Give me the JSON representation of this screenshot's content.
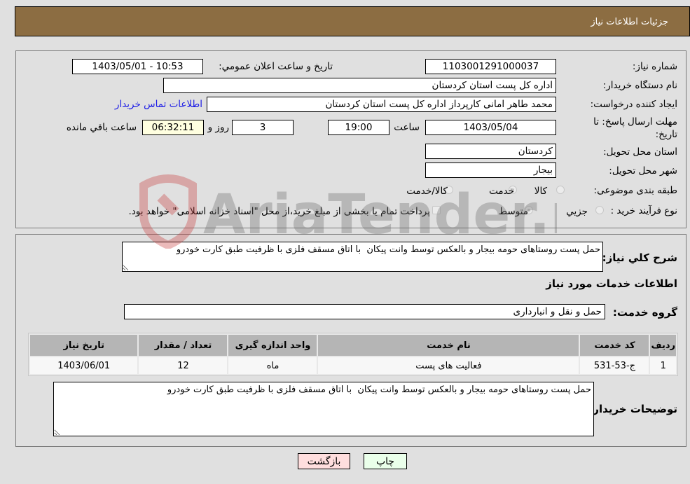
{
  "header": {
    "title": "جزئیات اطلاعات نیاز"
  },
  "info": {
    "need_number_label": "شماره نیاز:",
    "need_number": "1103001291000037",
    "announce_label": "تاریخ و ساعت اعلان عمومي:",
    "announce_value": "1403/05/01 - 10:53",
    "buyer_org_label": "نام دستگاه خریدار:",
    "buyer_org": "اداره کل پست استان کردستان",
    "requester_label": "ایجاد کننده درخواست:",
    "requester": "محمد طاهر امانی کارپرداز اداره کل پست استان کردستان",
    "contact_link": "اطلاعات تماس خریدار",
    "deadline_label": "مهلت ارسال پاسخ: تا تاریخ:",
    "deadline_date": "1403/05/04",
    "time_label": "ساعت",
    "deadline_time": "19:00",
    "days": "3",
    "days_label": "روز و",
    "remaining": "06:32:11",
    "remaining_label": "ساعت باقي مانده",
    "province_label": "استان محل تحویل:",
    "province": "کردستان",
    "city_label": "شهر محل تحویل:",
    "city": "بیجار",
    "category_label": "طبقه بندی موضوعی:",
    "category_options": [
      "کالا",
      "خدمت",
      "کالا/خدمت"
    ],
    "category_selected": "خدمت",
    "process_label": "نوع فرآیند خرید :",
    "process_options": [
      "جزيي",
      "متوسط"
    ],
    "process_selected": "متوسط",
    "payment_note": "پرداخت تمام یا بخشی از مبلغ خرید،از محل \"اسناد خزانه اسلامی\" خواهد بود."
  },
  "details": {
    "summary_label": "شرح کلي نیاز:",
    "summary": "حمل پست روستاهای حومه بیجار و بالعکس توسط وانت پیکان  با اتاق مسقف فلزی با ظرفیت طبق کارت خودرو",
    "services_heading": "اطلاعات خدمات مورد نیاز",
    "service_group_label": "گروه خدمت:",
    "service_group": "حمل و نقل و انبارداری",
    "table": {
      "headers": [
        "ردیف",
        "کد خدمت",
        "نام خدمت",
        "واحد اندازه گیری",
        "تعداد / مقدار",
        "تاریخ نیاز"
      ],
      "rows": [
        [
          "1",
          "ج-53-531",
          "فعالیت های پست",
          "ماه",
          "12",
          "1403/06/01"
        ]
      ]
    },
    "buyer_notes_label": "توضیحات خریدار:",
    "buyer_notes": "حمل پست روستاهای حومه بیجار و بالعکس توسط وانت پیکان  با اتاق مسقف فلزی با ظرفیت طبق کارت خودرو"
  },
  "buttons": {
    "print": "چاپ",
    "back": "بازگشت"
  },
  "watermark": "AriaTender.net",
  "colors": {
    "header_bg": "#8c6d42",
    "link": "#1a1ae6",
    "print_bg": "#eaffea",
    "back_bg": "#ffdede"
  }
}
